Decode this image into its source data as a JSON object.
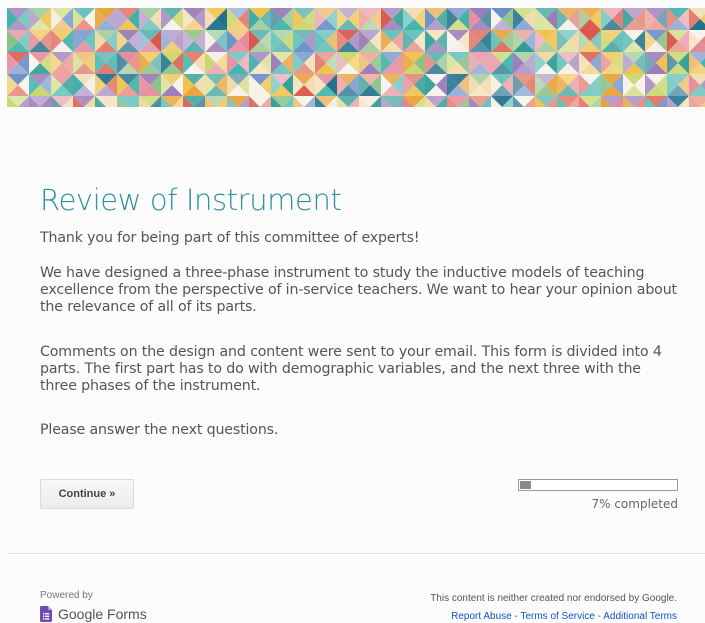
{
  "banner": {
    "palette": [
      "#2f9c95",
      "#3ab0a8",
      "#e8a33d",
      "#f0c24b",
      "#d9564a",
      "#e47b6c",
      "#9b7bb8",
      "#6a8fc9",
      "#8cc084",
      "#c9d66b",
      "#f2d8a7",
      "#e58b9b",
      "#1f6f8b",
      "#f4efe4"
    ]
  },
  "form": {
    "title": "Review of Instrument",
    "description": [
      "Thank you for being part of this committee of experts!",
      "We have designed a three-phase instrument to study the inductive models of teaching excellence from the perspective of in-service teachers. We want to hear your opinion about the relevance of all of its parts.",
      "Comments on the design and content were sent to your email. This form is divided into 4 parts. The first part has to do with demographic variables, and the next three with the three phases of the instrument.",
      "Please answer the next questions."
    ],
    "continue_label": "Continue »",
    "progress": {
      "fraction": 0.07,
      "label": "7% completed"
    }
  },
  "footer": {
    "powered_by": "Powered by",
    "product_name": "Google Forms",
    "disclaimer": "This content is neither created nor endorsed by Google.",
    "links": [
      "Report Abuse",
      "Terms of Service",
      "Additional Terms"
    ],
    "separator": " - "
  },
  "colors": {
    "title": "#2f8fa0",
    "link": "#1155cc",
    "forms_icon": "#7248b9"
  }
}
